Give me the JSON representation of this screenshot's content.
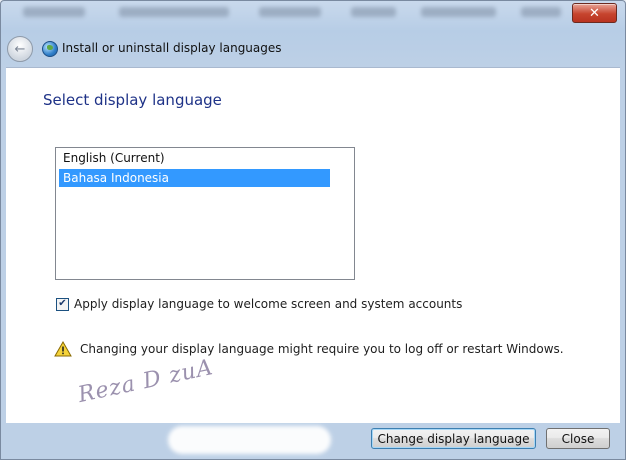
{
  "window": {
    "close_label": "✕"
  },
  "navbar": {
    "title": "Install or uninstall display languages"
  },
  "main": {
    "heading": "Select display language",
    "languages": [
      {
        "label": "English (Current)",
        "selected": false
      },
      {
        "label": "Bahasa Indonesia",
        "selected": true
      }
    ],
    "apply_checkbox": {
      "label": "Apply display language to welcome screen and system accounts",
      "checked": true
    },
    "warning_text": "Changing your display language might require you to log off or restart Windows."
  },
  "watermark": "Reza D zuA",
  "footer": {
    "change_button": "Change display language",
    "close_button": "Close"
  },
  "icons": {
    "back": "back-arrow-icon",
    "globe": "globe-icon",
    "warning": "warning-icon",
    "check": "checkmark-icon"
  },
  "colors": {
    "heading": "#1e3287",
    "selection": "#3399ff",
    "close_button": "#c6442e"
  }
}
